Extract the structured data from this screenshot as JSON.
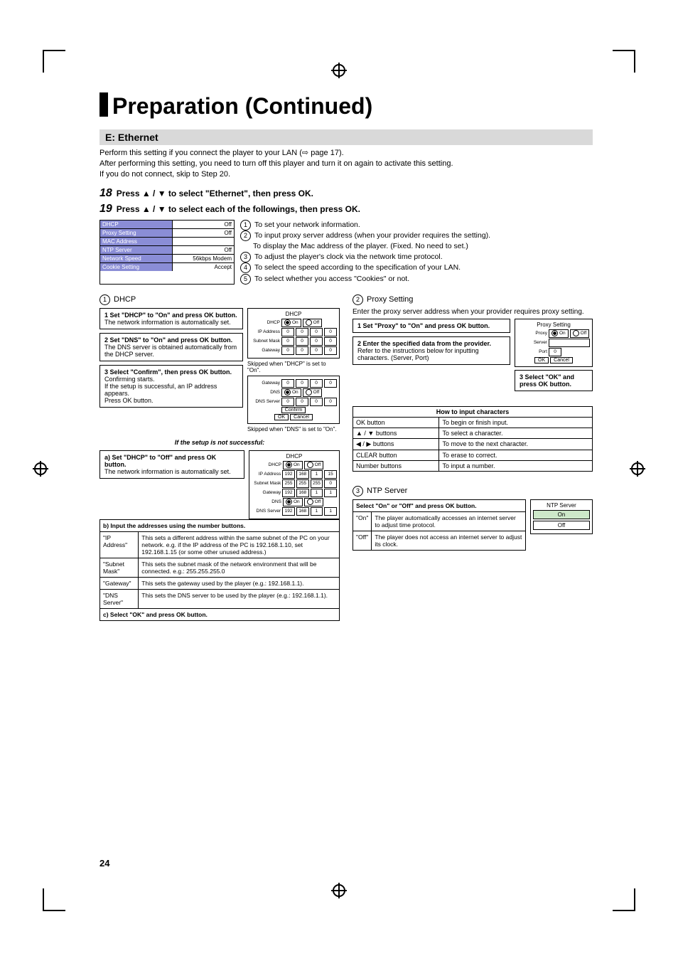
{
  "page_number": "24",
  "title": "Preparation (Continued)",
  "section": "E: Ethernet",
  "intro": {
    "l1": "Perform this setting if you connect the player to your LAN (",
    "l1b": " page 17).",
    "l2": "After performing this setting, you need to turn off this player and turn it on again to activate this setting.",
    "l3": "If you do not connect, skip to Step 20."
  },
  "steps": {
    "s18": "Press ▲ / ▼ to select \"Ethernet\", then press OK.",
    "s19": "Press ▲ / ▼ to select each of the followings, then press OK."
  },
  "menu": [
    {
      "label": "DHCP",
      "value": "Off"
    },
    {
      "label": "Proxy Setting",
      "value": "Off"
    },
    {
      "label": "MAC Address",
      "value": ""
    },
    {
      "label": "NTP Server",
      "value": "Off"
    },
    {
      "label": "Network Speed",
      "value": "56kbps Modem"
    },
    {
      "label": "Cookie Setting",
      "value": "Accept"
    }
  ],
  "numbered": {
    "n1": "To set your network information.",
    "n2": "To input proxy server address (when your provider requires the setting).",
    "n2b": "To display the Mac address of the player. (Fixed. No need to set.)",
    "n3": "To adjust the player's clock via the network time protocol.",
    "n4": "To select the speed according to the specification of your LAN.",
    "n5": "To select whether you access \"Cookies\" or not."
  },
  "dhcp": {
    "heading": "DHCP",
    "box1": {
      "t": "1  Set \"DHCP\" to \"On\" and press OK button.",
      "d": "The network information is automatically set."
    },
    "box2": {
      "t": "2  Set \"DNS\" to \"On\" and press OK button.",
      "d": "The DNS server is obtained automatically from the DHCP server."
    },
    "box3": {
      "t": "3  Select \"Confirm\", then press OK button.",
      "d": "Confirming starts.\nIf the setup is successful, an IP address appears.\nPress OK button."
    },
    "skip1": "Skipped when \"DHCP\" is set to \"On\".",
    "skip2": "Skipped when \"DNS\" is set to \"On\".",
    "fail": "If the setup is not successful:",
    "boxA": {
      "t": "a) Set \"DHCP\" to \"Off\" and press OK button.",
      "d": "The network information is automatically set."
    },
    "rowB": "b) Input the addresses using the number buttons.",
    "addr": [
      {
        "k": "\"IP Address\"",
        "v": "This sets a different address within the same subnet of the PC on your network. e.g. if the IP address of the PC is 192.168.1.10, set 192.168.1.15 (or some other unused address.)"
      },
      {
        "k": "\"Subnet Mask\"",
        "v": "This sets the subnet mask of the network environment that will be connected. e.g.: 255.255.255.0"
      },
      {
        "k": "\"Gateway\"",
        "v": "This sets the gateway used by the player (e.g.: 192.168.1.1)."
      },
      {
        "k": "\"DNS Server\"",
        "v": "This sets the DNS server to be used by the player (e.g.: 192.168.1.1)."
      }
    ],
    "rowC": "c) Select \"OK\" and press OK button.",
    "panel1": {
      "title": "DHCP",
      "rows": [
        "DHCP",
        "IP Address",
        "Subnet Mask",
        "Gateway"
      ],
      "radio_on": "On",
      "radio_off": "Off",
      "cells": [
        "0",
        "0",
        "0",
        "0"
      ]
    },
    "panel2": {
      "rows": [
        "Gateway",
        "DNS",
        "DNS Server"
      ],
      "confirm": "Confirm",
      "ok": "OK",
      "cancel": "Cancel"
    },
    "panel3": {
      "title": "DHCP",
      "rows": [
        "DHCP",
        "IP Address",
        "Subnet Mask",
        "Gateway",
        "DNS",
        "DNS Server"
      ],
      "ip": [
        "192",
        "168",
        "1",
        "15"
      ],
      "sm": [
        "255",
        "255",
        "255",
        "0"
      ],
      "gw": [
        "192",
        "168",
        "1",
        "1"
      ],
      "dns": [
        "192",
        "168",
        "1",
        "1"
      ]
    }
  },
  "proxy": {
    "heading": "Proxy Setting",
    "intro": "Enter the proxy server address when your provider requires proxy setting.",
    "box1": "1  Set \"Proxy\" to \"On\" and press OK button.",
    "box2": "2  Enter the specified data from the provider.",
    "box2d": "Refer to the instructions below for inputting characters. (Server, Port)",
    "box3": "3  Select \"OK\" and press OK button.",
    "panel": {
      "title": "Proxy Setting",
      "proxy": "Proxy",
      "on": "On",
      "off": "Off",
      "server": "Server",
      "port": "Port",
      "portval": "0",
      "ok": "OK",
      "cancel": "Cancel"
    },
    "chars_title": "How to input characters",
    "chars": [
      {
        "k": "OK button",
        "v": "To begin or finish input."
      },
      {
        "k": "▲ / ▼ buttons",
        "v": "To select a character."
      },
      {
        "k": "◀ / ▶ buttons",
        "v": "To move to the next character."
      },
      {
        "k": "CLEAR button",
        "v": "To erase to correct."
      },
      {
        "k": "Number buttons",
        "v": "To input a number."
      }
    ]
  },
  "ntp": {
    "heading": "NTP Server",
    "inst": "Select \"On\" or \"Off\" and press OK button.",
    "rows": [
      {
        "k": "\"On\"",
        "v": "The player automatically accesses an internet server to adjust time protocol."
      },
      {
        "k": "\"Off\"",
        "v": "The player does not access an internet server to adjust its clock."
      }
    ],
    "panel": {
      "title": "NTP Server",
      "on": "On",
      "off": "Off"
    }
  }
}
